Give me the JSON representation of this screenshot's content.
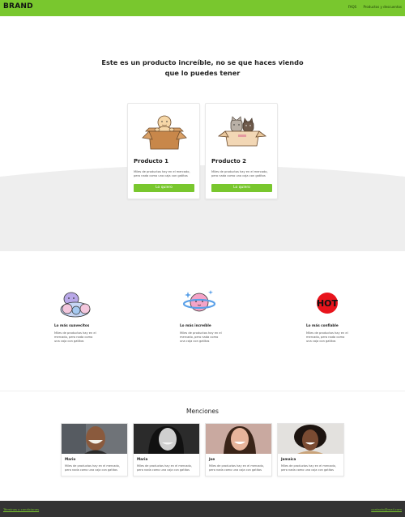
{
  "header": {
    "brand": "BRAND",
    "nav": [
      "FAQS",
      "Productos y descuentos"
    ]
  },
  "hero": {
    "title": "Este es un producto increíble, no se que haces viendo que lo puedes tener"
  },
  "products": [
    {
      "name": "Producto 1",
      "description": "Miles de productos hay en el mercado, pero nada como una caja con gatitos",
      "button": "Lo quiero",
      "image": "baby-in-box-illustration"
    },
    {
      "name": "Producto 2",
      "description": "Miles de productos hay en el mercado, pero nada como una caja con gatitos",
      "button": "Lo quiero",
      "image": "cats-in-box-illustration"
    }
  ],
  "features": [
    {
      "title": "Lo más suavecitos",
      "description": "Miles de productos hay en el mercado, pero nada como una caja con gatitos",
      "icon": "plush-toy-icon"
    },
    {
      "title": "Lo más increíble",
      "description": "Miles de productos hay en el mercado, pero nada como una caja con gatitos",
      "icon": "planet-icon"
    },
    {
      "title": "Lo más confiable",
      "description": "Miles de productos hay en el mercado, pero nada como una caja con gatitos",
      "icon": "hot-badge-icon",
      "badge_text": "HOT"
    }
  ],
  "mentions": {
    "title": "Menciones",
    "items": [
      {
        "name": "Mario",
        "description": "Miles de productos hay en el mercado, pero nada como una caja con gatitos"
      },
      {
        "name": "Maria",
        "description": "Miles de productos hay en el mercado, pero nada como una caja con gatitos"
      },
      {
        "name": "Joe",
        "description": "Miles de productos hay en el mercado, pero nada como una caja con gatitos"
      },
      {
        "name": "Jamaica",
        "description": "Miles de productos hay en el mercado, pero nada como una caja con gatitos"
      }
    ]
  },
  "footer": {
    "terms": "Términos y condiciones",
    "email": "contacto@mail.com"
  },
  "colors": {
    "accent": "#79c72e",
    "footer_bg": "#333333",
    "band_bg": "#eeeeee"
  }
}
